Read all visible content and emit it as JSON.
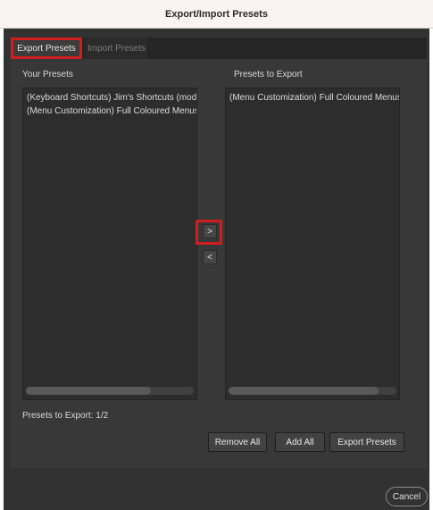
{
  "window": {
    "title": "Export/Import Presets"
  },
  "tabs": [
    {
      "label": "Export Presets",
      "active": true
    },
    {
      "label": "Import Presets",
      "active": false
    }
  ],
  "your_presets": {
    "heading": "Your Presets",
    "items": [
      "(Keyboard Shortcuts)  Jim's Shortcuts (modifie",
      "(Menu Customization)  Full Coloured Menus.mi"
    ]
  },
  "presets_to_export": {
    "heading": "Presets to Export",
    "items": [
      "(Menu Customization)  Full Coloured Menus.mi"
    ]
  },
  "move_buttons": {
    "add": ">",
    "remove": "<"
  },
  "status": {
    "count_text": "Presets to Export: 1/2"
  },
  "actions": {
    "remove_all": "Remove All",
    "add_all": "Add All",
    "export": "Export Presets"
  },
  "footer": {
    "cancel": "Cancel"
  },
  "colors": {
    "highlight": "#d11d1d",
    "background": "#323232",
    "panel": "#383838",
    "list": "#2d2d2d"
  }
}
